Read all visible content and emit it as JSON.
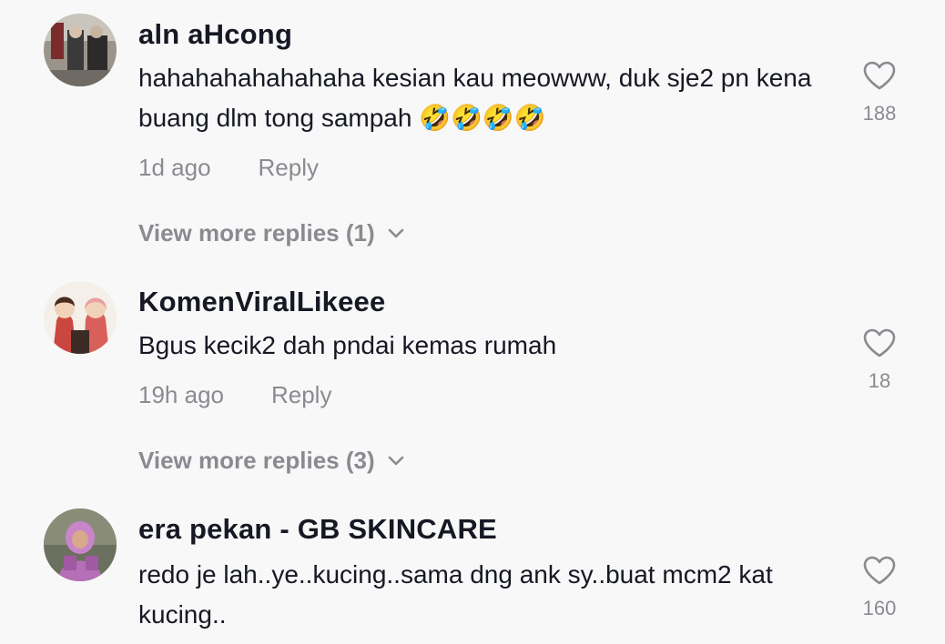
{
  "comments": [
    {
      "username": "aln aHcong",
      "text": "hahahahahahahaha kesian kau meowww, duk sje2 pn kena buang dlm tong sampah 🤣🤣🤣🤣",
      "time": "1d ago",
      "reply_label": "Reply",
      "likes": "188",
      "view_more": "View more replies (1)",
      "avatar_icon": "user-avatar-photo"
    },
    {
      "username": "KomenViralLikeee",
      "text": "Bgus kecik2 dah pndai kemas rumah",
      "time": "19h ago",
      "reply_label": "Reply",
      "likes": "18",
      "view_more": "View more replies (3)",
      "avatar_icon": "user-avatar-cartoon"
    },
    {
      "username": "era pekan - GB SKINCARE",
      "text": "redo je lah..ye..kucing..sama dng ank sy..buat mcm2 kat kucing..",
      "likes": "160",
      "avatar_icon": "user-avatar-photo"
    }
  ],
  "colors": {
    "background": "#f8f8f8",
    "primary_text": "#161823",
    "secondary_text": "#8a8b91"
  }
}
